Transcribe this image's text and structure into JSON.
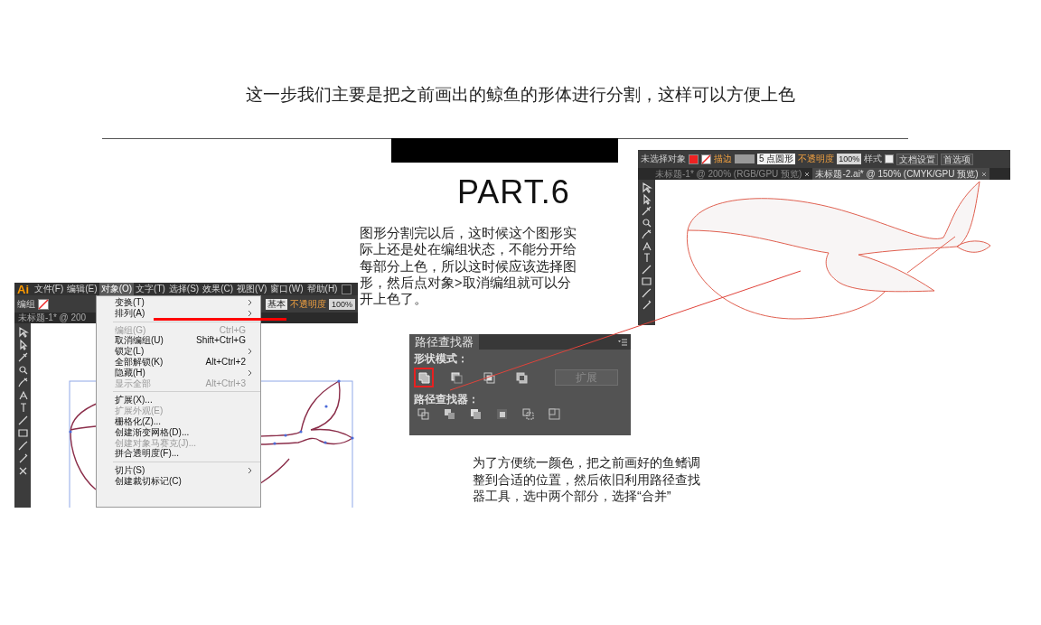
{
  "heading": "这一步我们主要是把之前画出的鲸鱼的形体进行分割，这样可以方便上色",
  "part_title": "PART.6",
  "intro_text": "图形分割完以后，这时候这个图形实际上还是处在编组状态，不能分开给每部分上色，所以这时候应该选择图形，然后点对象>取消编组就可以分开上色了。",
  "menu_screenshot": {
    "logo": "Ai",
    "menu_bar": [
      {
        "label": "文件(F)",
        "selected": false
      },
      {
        "label": "编辑(E)",
        "selected": false
      },
      {
        "label": "对象(O)",
        "selected": true
      },
      {
        "label": "文字(T)",
        "selected": false
      },
      {
        "label": "选择(S)",
        "selected": false
      },
      {
        "label": "效果(C)",
        "selected": false
      },
      {
        "label": "视图(V)",
        "selected": false
      },
      {
        "label": "窗口(W)",
        "selected": false
      },
      {
        "label": "帮助(H)",
        "selected": false
      }
    ],
    "control_label": "编组",
    "brush_preset": "基本",
    "opacity_label": "不透明度",
    "opacity_value": "100%",
    "document_tab": "未标题-1* @ 200",
    "menu_groups": [
      [
        {
          "label": "变换(T)",
          "submenu": true,
          "disabled": false
        },
        {
          "label": "排列(A)",
          "submenu": true,
          "disabled": false
        }
      ],
      [
        {
          "label": "编组(G)",
          "shortcut": "Ctrl+G",
          "submenu": false,
          "disabled": true
        },
        {
          "label": "取消编组(U)",
          "shortcut": "Shift+Ctrl+G",
          "submenu": false,
          "disabled": false
        },
        {
          "label": "锁定(L)",
          "submenu": true,
          "disabled": false
        },
        {
          "label": "全部解锁(K)",
          "shortcut": "Alt+Ctrl+2",
          "submenu": false,
          "disabled": false
        },
        {
          "label": "隐藏(H)",
          "submenu": true,
          "disabled": false
        },
        {
          "label": "显示全部",
          "shortcut": "Alt+Ctrl+3",
          "submenu": false,
          "disabled": true
        }
      ],
      [
        {
          "label": "扩展(X)...",
          "submenu": false,
          "disabled": false
        },
        {
          "label": "扩展外观(E)",
          "submenu": false,
          "disabled": true
        },
        {
          "label": "栅格化(Z)...",
          "submenu": false,
          "disabled": false
        },
        {
          "label": "创建渐变网格(D)...",
          "submenu": false,
          "disabled": false
        },
        {
          "label": "创建对象马赛克(J)...",
          "submenu": false,
          "disabled": true
        },
        {
          "label": "拼合透明度(F)...",
          "submenu": false,
          "disabled": false
        }
      ],
      [
        {
          "label": "切片(S)",
          "submenu": true,
          "disabled": false
        },
        {
          "label": "创建裁切标记(C)",
          "submenu": false,
          "disabled": false
        }
      ]
    ]
  },
  "whale_screenshot": {
    "selection_label": "未选择对象",
    "stroke_label": "描边",
    "brush": "5 点圆形",
    "opacity_label": "不透明度",
    "opacity_value": "100%",
    "style_label": "样式",
    "buttons": [
      "文档设置",
      "首选项"
    ],
    "tabs": [
      {
        "label": "未标题-1* @ 200% (RGB/GPU 预览)",
        "selected": false
      },
      {
        "label": "未标题-2.ai* @ 150% (CMYK/GPU 预览)",
        "selected": true
      }
    ]
  },
  "pathfinder": {
    "title": "路径查找器",
    "shape_modes_label": "形状模式：",
    "shape_modes": [
      {
        "selected": true
      },
      {
        "selected": false
      },
      {
        "selected": false
      },
      {
        "selected": false
      }
    ],
    "expand_button": {
      "label": "扩展",
      "disabled": true
    },
    "pathfinders_label": "路径查找器："
  },
  "note_text": "为了方便统一颜色，把之前画好的鱼鳍调整到合适的位置，然后依旧利用路径查找器工具，选中两个部分，选择“合并”"
}
